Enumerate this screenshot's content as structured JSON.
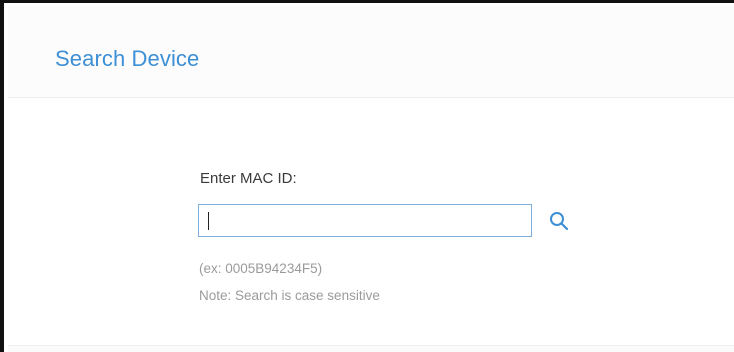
{
  "header": {
    "title": "Search Device"
  },
  "search_form": {
    "label": "Enter MAC ID:",
    "input_value": "",
    "example_text": "(ex: 0005B94234F5)",
    "note_text": "Note: Search is case sensitive",
    "search_icon": "search-icon",
    "accent_color": "#3d8fd6"
  }
}
